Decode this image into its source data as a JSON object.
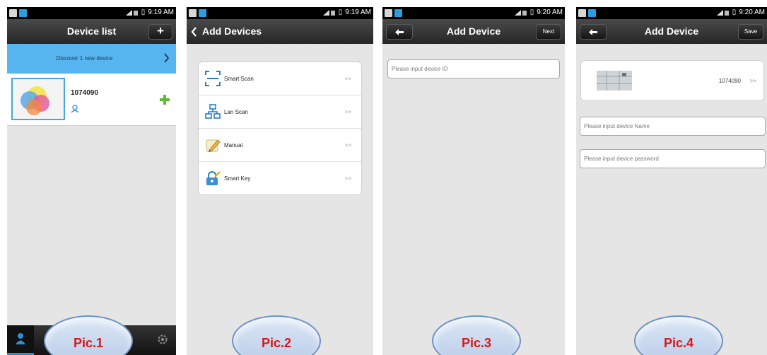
{
  "status_icons": [
    "gallery-icon",
    "app-icon",
    "wifi-icon",
    "signal-icon",
    "battery-icon"
  ],
  "pic1": {
    "time": "9:19 AM",
    "title": "Device list",
    "add_button": "+",
    "discover_text": "Discover  1  new device",
    "device_id": "1074090",
    "caption": "Pic.1"
  },
  "pic2": {
    "time": "9:19 AM",
    "title": "Add Devices",
    "menu": [
      {
        "label": "Smart Scan",
        "arrow": ">>",
        "icon": "scan-icon"
      },
      {
        "label": "Lan Scan",
        "arrow": ">>",
        "icon": "network-icon"
      },
      {
        "label": "Manual",
        "arrow": ">>",
        "icon": "pencil-icon"
      },
      {
        "label": "Smart Key",
        "arrow": ">>",
        "icon": "lock-key-icon"
      }
    ],
    "caption": "Pic.2"
  },
  "pic3": {
    "time": "9:20 AM",
    "title": "Add Device",
    "next_button": "Next",
    "device_id_placeholder": "Please input device ID",
    "caption": "Pic.3"
  },
  "pic4": {
    "time": "9:20 AM",
    "title": "Add Device",
    "save_button": "Save",
    "device_id": "1074090",
    "device_arrow": ">>",
    "name_placeholder": "Please input device Name",
    "password_placeholder": "Please input device password",
    "caption": "Pic.4"
  },
  "colors": {
    "accent_blue": "#56b4ef",
    "caption_red": "#d6191a",
    "titlebar_dark": "#2b2b2b",
    "background_gray": "#e5e5e5"
  }
}
